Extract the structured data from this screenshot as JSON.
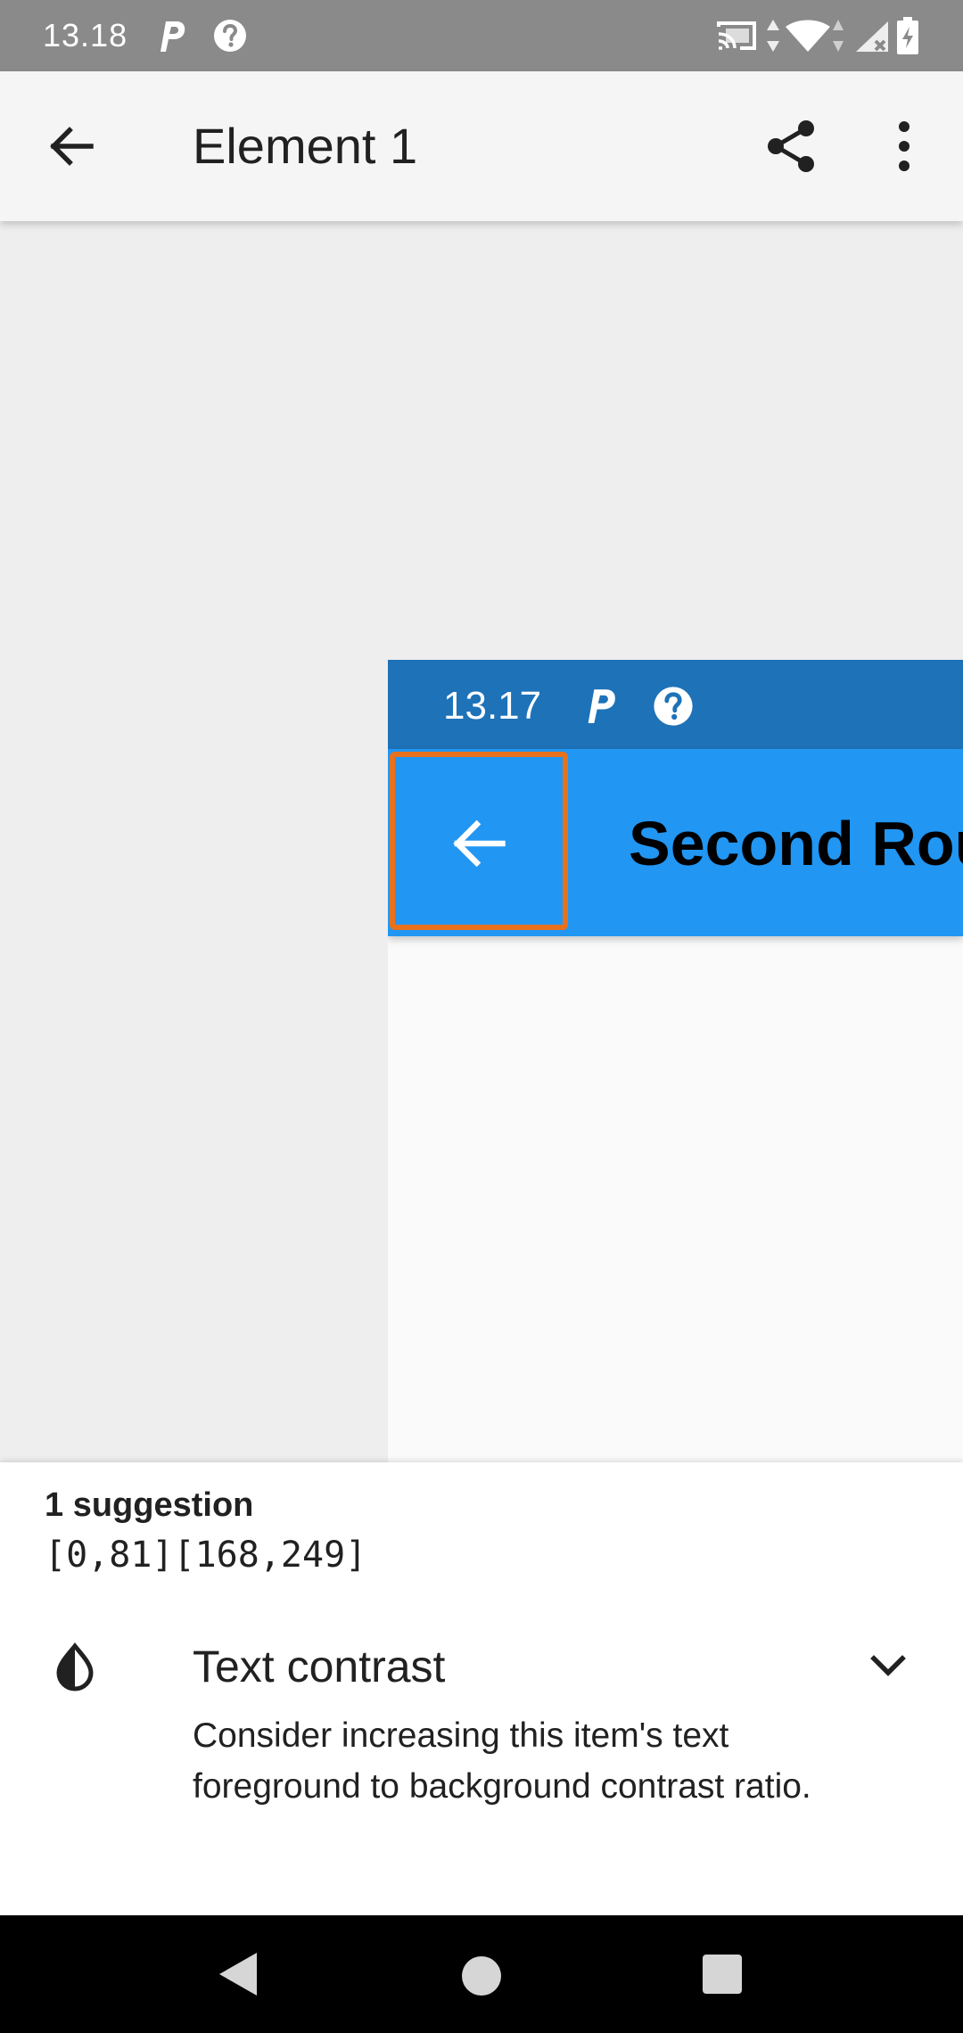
{
  "status_bar": {
    "time": "13.18",
    "left_icons": [
      "parking-icon",
      "help-circle-icon"
    ],
    "right_icons": [
      "cast-icon",
      "data-arrows-icon",
      "wifi-icon",
      "cell-signal-icon",
      "battery-icon"
    ]
  },
  "app_bar": {
    "title": "Element 1",
    "back_icon": "arrow-back-icon",
    "share_icon": "share-icon",
    "more_icon": "more-vert-icon"
  },
  "preview": {
    "status_time": "13.17",
    "toolbar_title": "Second Rou",
    "highlight_color": "#e8711c",
    "toolbar_color": "#2196f3",
    "status_color": "#1e72b8"
  },
  "sheet": {
    "suggestion_count": "1 suggestion",
    "bounds": "[0,81][168,249]",
    "item_title": "Text contrast",
    "item_description": "Consider increasing this item's text foreground to background contrast ratio.",
    "item_icon": "contrast-icon",
    "expand_icon": "chevron-down-icon"
  },
  "nav_bar": {
    "buttons": [
      "back-triangle-icon",
      "home-circle-icon",
      "recents-square-icon"
    ]
  }
}
